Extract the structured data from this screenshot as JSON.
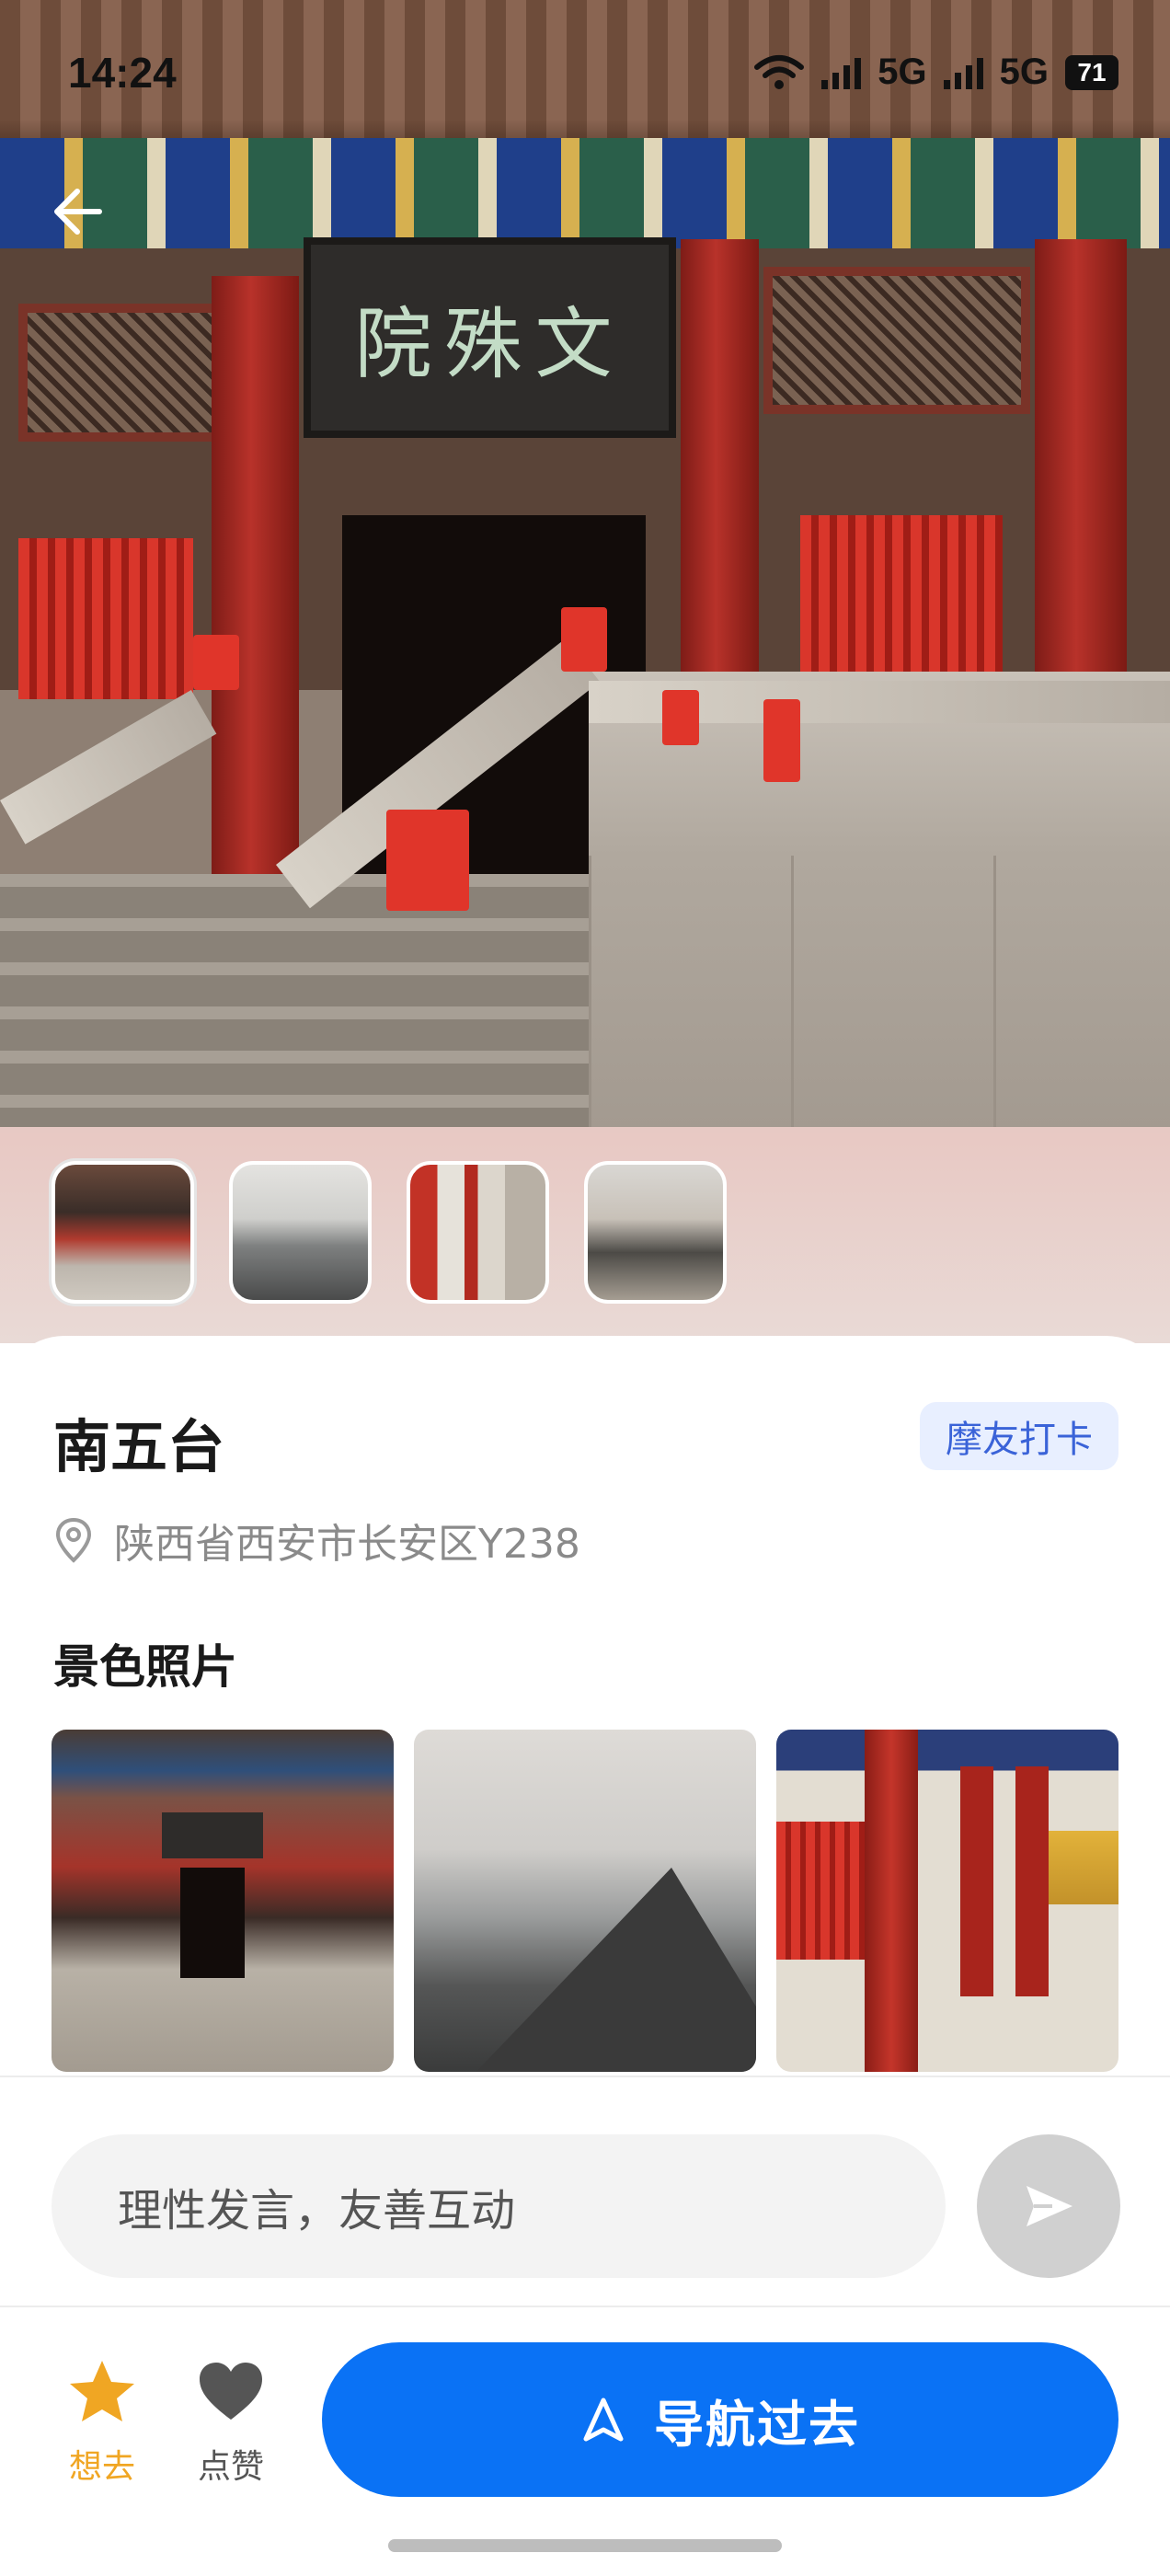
{
  "status_bar": {
    "time": "14:24",
    "network_1": "5G",
    "network_2": "5G",
    "battery": "71"
  },
  "hero": {
    "plaque_text": "院殊文",
    "thumbnails": [
      {
        "name": "thumb-temple-front",
        "selected": true
      },
      {
        "name": "thumb-mountain"
      },
      {
        "name": "thumb-corridor"
      },
      {
        "name": "thumb-incense-burner"
      }
    ]
  },
  "place": {
    "title": "南五台",
    "badge": "摩友打卡",
    "address": "陕西省西安市长安区Y238"
  },
  "photos": {
    "section_title": "景色照片"
  },
  "comment": {
    "placeholder": "理性发言，友善互动"
  },
  "actions": {
    "want_label": "想去",
    "like_label": "点赞",
    "navigate_label": "导航过去"
  },
  "colors": {
    "accent": "#0A72F5",
    "badge_bg": "#E8EFFF",
    "badge_text": "#3A63D8",
    "star": "#F0A623"
  },
  "icons": [
    "back-arrow-icon",
    "location-pin-icon",
    "send-icon",
    "star-icon",
    "heart-icon",
    "navigation-arrow-icon"
  ]
}
